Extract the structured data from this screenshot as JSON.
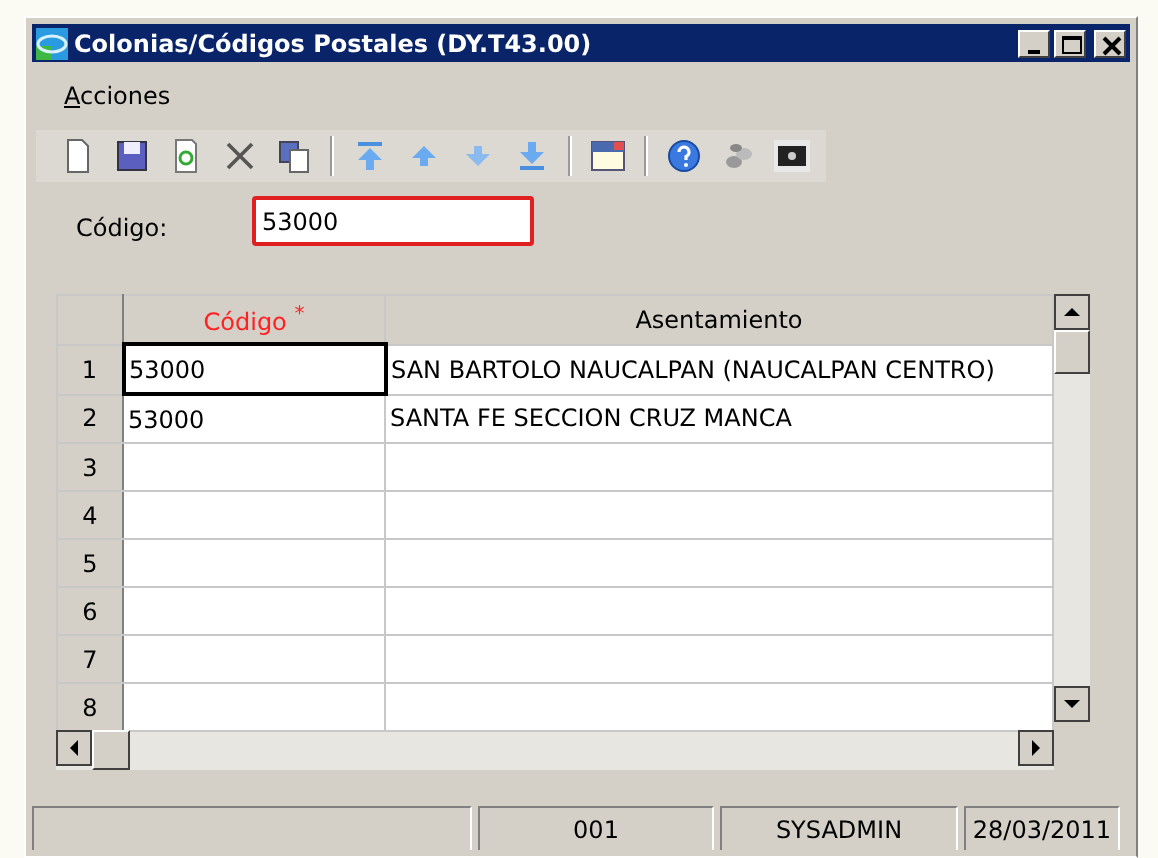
{
  "window": {
    "title": "Colonias/Códigos Postales (DY.T43.00)"
  },
  "menu": [
    {
      "label": "Acciones"
    }
  ],
  "toolbar": [
    {
      "kind": "new"
    },
    {
      "kind": "save"
    },
    {
      "kind": "refresh"
    },
    {
      "kind": "delete"
    },
    {
      "kind": "copy"
    },
    {
      "kind": "sep"
    },
    {
      "kind": "first"
    },
    {
      "kind": "up"
    },
    {
      "kind": "down"
    },
    {
      "kind": "last"
    },
    {
      "kind": "sep"
    },
    {
      "kind": "window"
    },
    {
      "kind": "sep"
    },
    {
      "kind": "help"
    },
    {
      "kind": "coins"
    },
    {
      "kind": "screen"
    }
  ],
  "filter": {
    "label": "Código:",
    "value": "53000"
  },
  "table": {
    "columns": [
      {
        "label": "Código $^{*}$",
        "required": true
      },
      {
        "label": "Asentamiento",
        "required": false
      }
    ],
    "rows": [
      {
        "number": "1",
        "codigo": "53000",
        "asentamiento": "SAN BARTOLO NAUCALPAN (NAUCALPAN CENTRO)",
        "selected": true
      },
      {
        "number": "2",
        "codigo": "53000",
        "asentamiento": "SANTA FE SECCION CRUZ MANCA",
        "selected": false
      },
      {
        "number": "3",
        "selected": false
      },
      {
        "number": "4",
        "selected": false
      },
      {
        "number": "5",
        "selected": false
      },
      {
        "number": "6",
        "selected": false
      },
      {
        "number": "7",
        "selected": false
      },
      {
        "number": "8",
        "selected": false
      }
    ]
  },
  "status_bar": [
    "001",
    "SYSADMIN",
    "28/03/2011"
  ]
}
